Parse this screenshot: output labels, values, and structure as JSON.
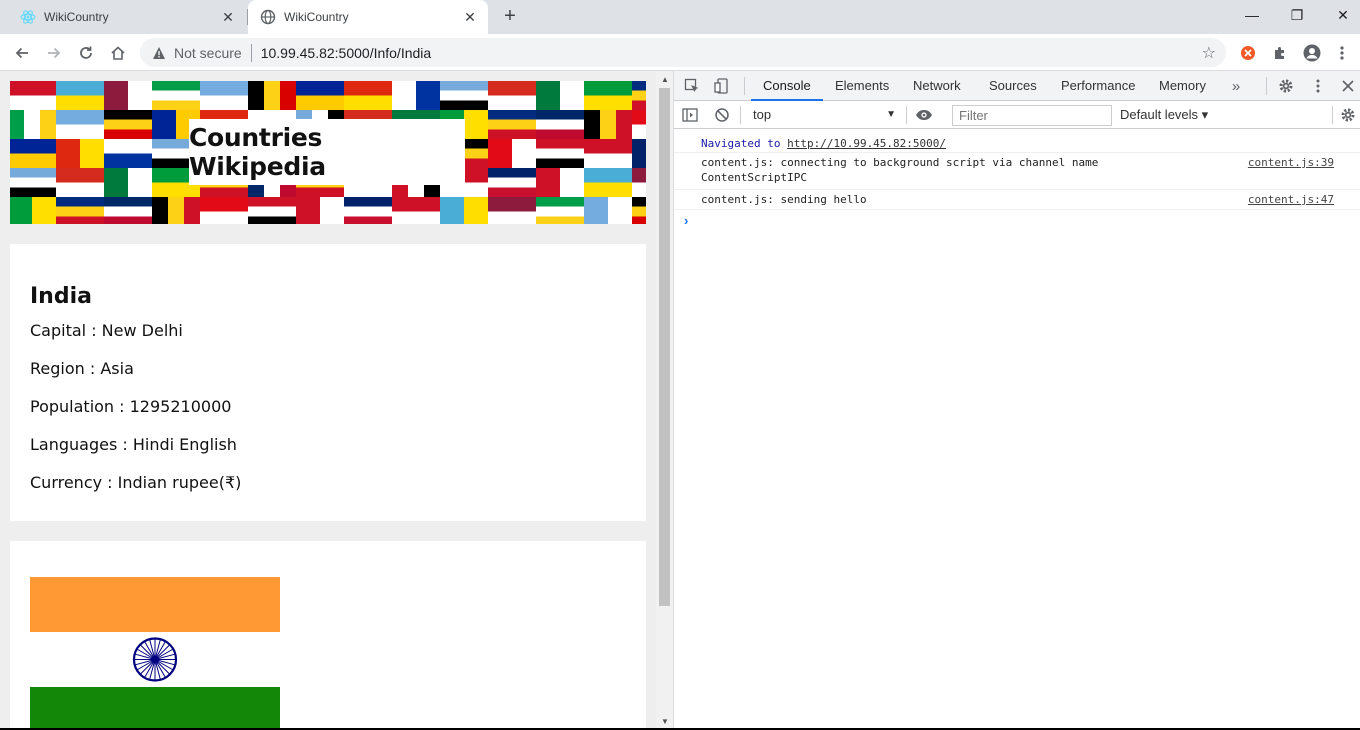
{
  "browser": {
    "tabs": [
      {
        "title": "WikiCountry",
        "icon": "react-icon",
        "active": false
      },
      {
        "title": "WikiCountry",
        "icon": "globe-icon",
        "active": true
      }
    ],
    "new_tab": "+",
    "window_controls": {
      "minimize": "—",
      "restore": "❐",
      "close": "✕"
    },
    "address": {
      "security_label": "Not secure",
      "url": "10.99.45.82:5000/Info/India"
    }
  },
  "page": {
    "banner_title": "Countries Wikipedia",
    "country": {
      "name": "India",
      "lines": [
        {
          "label": "Capital : New Delhi"
        },
        {
          "label": "Region : Asia"
        },
        {
          "label": "Population : 1295210000"
        },
        {
          "label": "Languages : Hindi English"
        },
        {
          "label": "Currency : Indian rupee(₹)"
        }
      ]
    },
    "flag_colors": {
      "saffron": "#ff9933",
      "white": "#ffffff",
      "green": "#138808",
      "chakra": "#000080"
    }
  },
  "devtools": {
    "tabs": [
      "Console",
      "Elements",
      "Network",
      "Sources",
      "Performance",
      "Memory"
    ],
    "more": "»",
    "context": "top",
    "filter_placeholder": "Filter",
    "levels": "Default levels ▾",
    "messages": [
      {
        "prefix": "Navigated to ",
        "link": "http://10.99.45.82:5000/",
        "source": ""
      },
      {
        "line1": "content.js: connecting to background script via channel name",
        "line2": "ContentScriptIPC",
        "source": "content.js:39"
      },
      {
        "line1": "content.js: sending hello",
        "source": "content.js:47"
      }
    ],
    "prompt": "›"
  },
  "colors": {
    "accent": "#1a73e8",
    "tabstrip": "#dee1e6",
    "page_bg": "#eeeeee"
  }
}
